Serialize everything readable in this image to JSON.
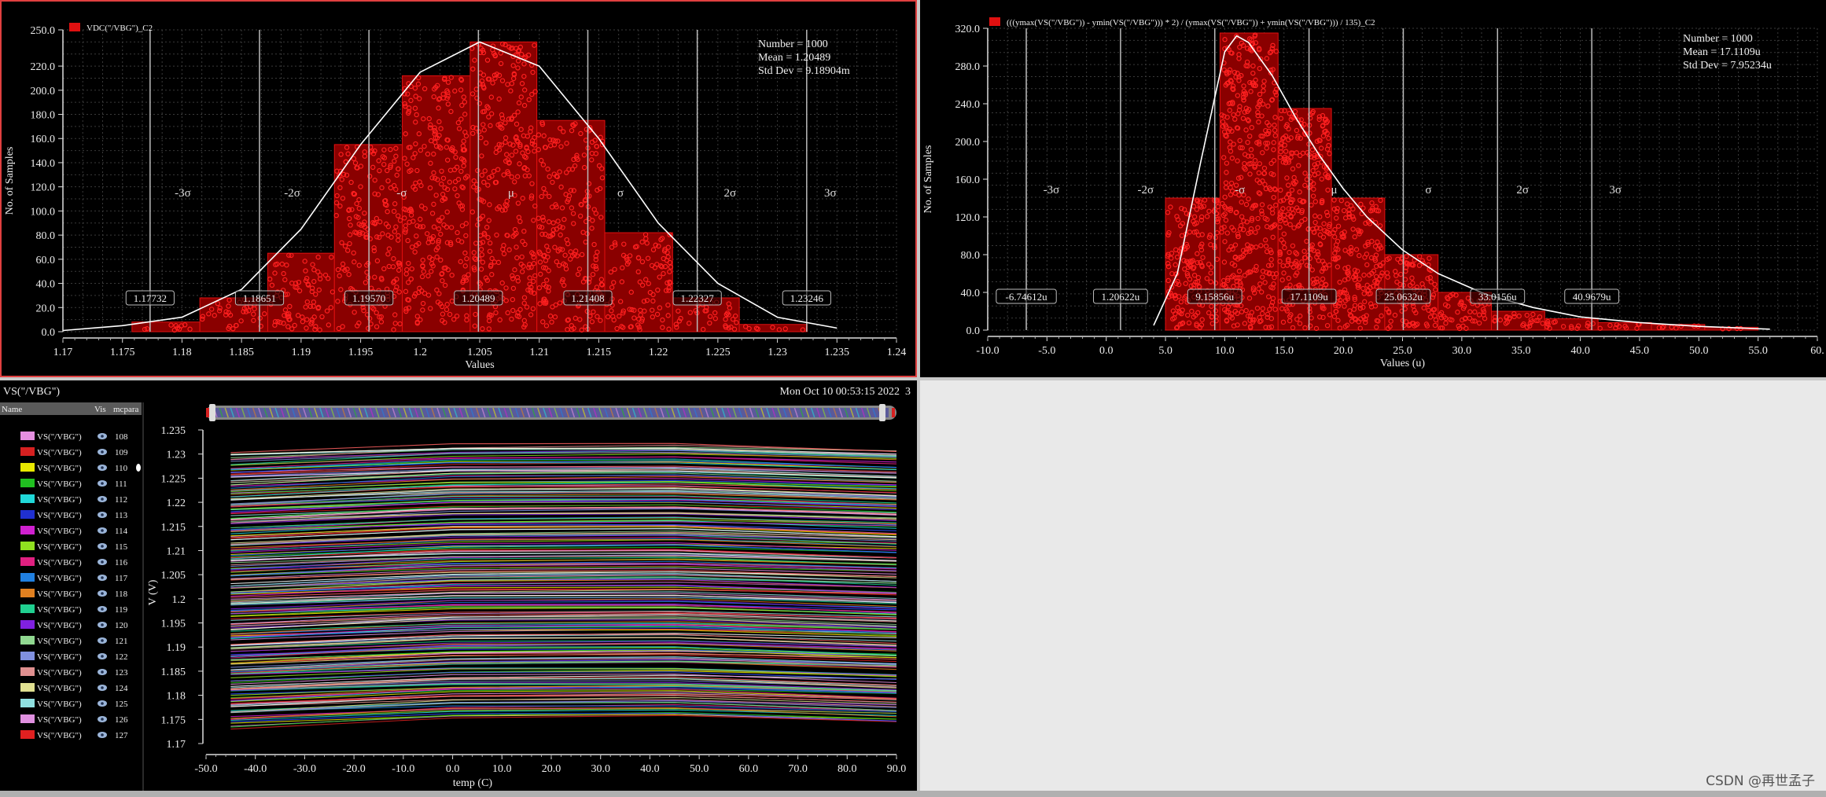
{
  "histograms": [
    {
      "legend": "VDC(\"/VBG\")_C2",
      "stats": [
        "Number = 1000",
        "Mean = 1.20489",
        "Std Dev = 9.18904m"
      ],
      "ylabel": "No. of Samples",
      "xlabel": "Values",
      "x_ticks": [
        "1.17",
        "1.175",
        "1.18",
        "1.185",
        "1.19",
        "1.195",
        "1.2",
        "1.205",
        "1.21",
        "1.215",
        "1.22",
        "1.225",
        "1.23",
        "1.235",
        "1.24"
      ],
      "y_ticks": [
        "0.0",
        "20.0",
        "40.0",
        "60.0",
        "80.0",
        "100.0",
        "120.0",
        "140.0",
        "160.0",
        "180.0",
        "200.0",
        "220.0",
        "250.0"
      ],
      "sigma_labels": [
        "-3σ",
        "-2σ",
        "-σ",
        "μ",
        "σ",
        "2σ",
        "3σ"
      ],
      "sigma_values": [
        "1.17732",
        "1.18651",
        "1.19570",
        "1.20489",
        "1.21408",
        "1.22327",
        "1.23246"
      ]
    },
    {
      "legend": "(((ymax(VS(\"/VBG\")) - ymin(VS(\"/VBG\"))) * 2) / (ymax(VS(\"/VBG\")) + ymin(VS(\"/VBG\"))) / 135)_C2",
      "stats": [
        "Number = 1000",
        "Mean = 17.1109u",
        "Std Dev = 7.95234u"
      ],
      "ylabel": "No. of Samples",
      "xlabel": "Values (u)",
      "x_ticks": [
        "-10.0",
        "-5.0",
        "0.0",
        "5.0",
        "10.0",
        "15.0",
        "20.0",
        "25.0",
        "30.0",
        "35.0",
        "40.0",
        "45.0",
        "50.0",
        "55.0",
        "60."
      ],
      "y_ticks": [
        "0.0",
        "40.0",
        "80.0",
        "120.0",
        "160.0",
        "200.0",
        "240.0",
        "280.0",
        "320.0"
      ],
      "sigma_labels": [
        "-3σ",
        "-2σ",
        "-σ",
        "μ",
        "σ",
        "2σ",
        "3σ"
      ],
      "sigma_values": [
        "-6.74612u",
        "1.20622u",
        "9.15856u",
        "17.1109u",
        "25.0632u",
        "33.0156u",
        "40.9679u"
      ]
    }
  ],
  "chart_data": [
    {
      "type": "bar",
      "title": "",
      "xlabel": "Values",
      "ylabel": "No. of Samples",
      "xlim": [
        1.17,
        1.24
      ],
      "ylim": [
        0,
        250
      ],
      "bin_edges": [
        1.1758,
        1.1815,
        1.1872,
        1.1928,
        1.1985,
        1.2042,
        1.2098,
        1.2155,
        1.2212,
        1.2268,
        1.2325
      ],
      "values": [
        8,
        28,
        65,
        155,
        212,
        240,
        175,
        82,
        28,
        6
      ],
      "fit_curve": {
        "x": [
          1.17,
          1.175,
          1.18,
          1.185,
          1.19,
          1.195,
          1.2,
          1.205,
          1.21,
          1.215,
          1.22,
          1.225,
          1.23,
          1.235
        ],
        "y": [
          1,
          5,
          12,
          35,
          85,
          155,
          215,
          240,
          220,
          160,
          90,
          40,
          12,
          3
        ]
      },
      "grid": true,
      "legend": "top-left"
    },
    {
      "type": "bar",
      "title": "",
      "xlabel": "Values (u)",
      "ylabel": "No. of Samples",
      "xlim": [
        -10,
        60
      ],
      "ylim": [
        0,
        320
      ],
      "bin_edges": [
        5.0,
        9.6,
        14.5,
        19.0,
        23.5,
        28.0,
        32.5,
        37.0,
        41.5,
        46.0,
        50.5,
        55.0
      ],
      "values": [
        140,
        315,
        235,
        140,
        80,
        40,
        20,
        12,
        8,
        6,
        3
      ],
      "fit_curve": {
        "x": [
          4,
          6,
          8,
          10,
          11,
          12,
          14,
          16,
          18,
          20,
          22,
          25,
          28,
          32,
          36,
          40,
          45,
          50,
          56
        ],
        "y": [
          5,
          60,
          180,
          295,
          312,
          305,
          270,
          225,
          185,
          150,
          120,
          85,
          60,
          38,
          24,
          14,
          8,
          4,
          1
        ]
      },
      "grid": true,
      "legend": "top-left"
    },
    {
      "type": "line",
      "title": "VS(\"/VBG\")",
      "xlabel": "temp (C)",
      "ylabel": "V (V)",
      "xlim": [
        -50,
        90
      ],
      "ylim": [
        1.17,
        1.235
      ],
      "x_ticks": [
        "-50.0",
        "-40.0",
        "-30.0",
        "-20.0",
        "-10.0",
        "0.0",
        "10.0",
        "20.0",
        "30.0",
        "40.0",
        "50.0",
        "60.0",
        "70.0",
        "80.0",
        "90.0"
      ],
      "y_ticks": [
        "1.17",
        "1.175",
        "1.18",
        "1.185",
        "1.19",
        "1.195",
        "1.2",
        "1.205",
        "1.21",
        "1.215",
        "1.22",
        "1.225",
        "1.23",
        "1.235"
      ],
      "x_range": [
        -45,
        90
      ],
      "series_count": 1000,
      "v_range": [
        1.174,
        1.234
      ],
      "grid": false
    }
  ],
  "waveform": {
    "title": "VS(\"/VBG\")",
    "timestamp": "Mon Oct 10 00:53:15 2022",
    "page": "3",
    "columns": [
      "Name",
      "Vis",
      "mcpara"
    ],
    "signals": [
      {
        "name": "VS(\"/VBG\")",
        "id": "108",
        "color": "#e58fe0"
      },
      {
        "name": "VS(\"/VBG\")",
        "id": "109",
        "color": "#d62020"
      },
      {
        "name": "VS(\"/VBG\")",
        "id": "110",
        "color": "#e8e800"
      },
      {
        "name": "VS(\"/VBG\")",
        "id": "111",
        "color": "#20c020"
      },
      {
        "name": "VS(\"/VBG\")",
        "id": "112",
        "color": "#20d8d8"
      },
      {
        "name": "VS(\"/VBG\")",
        "id": "113",
        "color": "#2030d0"
      },
      {
        "name": "VS(\"/VBG\")",
        "id": "114",
        "color": "#d020d0"
      },
      {
        "name": "VS(\"/VBG\")",
        "id": "115",
        "color": "#90e020"
      },
      {
        "name": "VS(\"/VBG\")",
        "id": "116",
        "color": "#e02080"
      },
      {
        "name": "VS(\"/VBG\")",
        "id": "117",
        "color": "#2080e0"
      },
      {
        "name": "VS(\"/VBG\")",
        "id": "118",
        "color": "#e08020"
      },
      {
        "name": "VS(\"/VBG\")",
        "id": "119",
        "color": "#20d090"
      },
      {
        "name": "VS(\"/VBG\")",
        "id": "120",
        "color": "#8020e0"
      },
      {
        "name": "VS(\"/VBG\")",
        "id": "121",
        "color": "#90d890"
      },
      {
        "name": "VS(\"/VBG\")",
        "id": "122",
        "color": "#8090e0"
      },
      {
        "name": "VS(\"/VBG\")",
        "id": "123",
        "color": "#e09090"
      },
      {
        "name": "VS(\"/VBG\")",
        "id": "124",
        "color": "#e0e090"
      },
      {
        "name": "VS(\"/VBG\")",
        "id": "125",
        "color": "#90e0e0"
      },
      {
        "name": "VS(\"/VBG\")",
        "id": "126",
        "color": "#e090e0"
      },
      {
        "name": "VS(\"/VBG\")",
        "id": "127",
        "color": "#e02020"
      }
    ]
  },
  "watermark": "CSDN @再世孟子",
  "colors": {
    "bar_fill": "#8a0000",
    "bar_edge": "#e01010",
    "curve": "#ffffff",
    "background": "#000000",
    "grid": "#3a3a3a"
  }
}
